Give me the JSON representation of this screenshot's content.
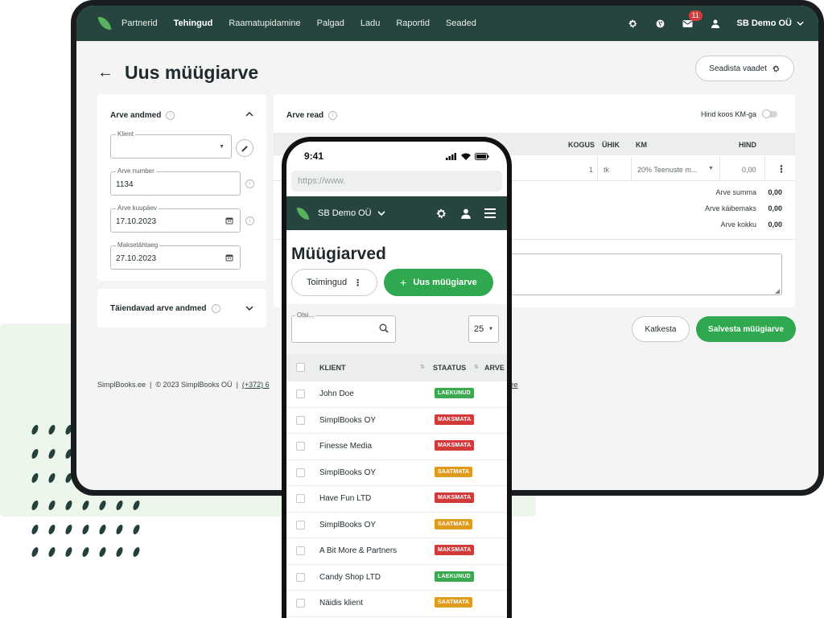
{
  "colors": {
    "brand_dark": "#27453f",
    "accent_green": "#2fa84f",
    "status_paid": "#3aa94f",
    "status_unpaid": "#d23a3a",
    "status_sent": "#e19b1c"
  },
  "desktop": {
    "nav": {
      "items": [
        "Partnerid",
        "Tehingud",
        "Raamatupidamine",
        "Palgad",
        "Ladu",
        "Raportid",
        "Seaded"
      ],
      "active": "Tehingud",
      "notification_count": "11",
      "company": "SB Demo OÜ",
      "icons": [
        "gear-icon",
        "globe-icon",
        "mail-icon",
        "user-icon"
      ]
    },
    "page_title": "Uus müügiarve",
    "settings_button": "Seadista vaadet",
    "invoice_details": {
      "title": "Arve andmed",
      "client_label": "Klient",
      "client_value": "",
      "number_label": "Arve number",
      "number_value": "1134",
      "date_label": "Arve kuupäev",
      "date_value": "17.10.2023",
      "due_label": "Maksetähtaeg",
      "due_value": "27.10.2023"
    },
    "extra_details_title": "Täiendavad arve andmed",
    "invoice_rows": {
      "title": "Arve read",
      "vat_toggle_label": "Hind koos KM-ga",
      "columns": {
        "qty": "KOGUS",
        "unit": "ÜHIK",
        "vat": "KM",
        "price": "HIND"
      },
      "row": {
        "qty": "1",
        "unit": "tk",
        "vat": "20% Teenuste m...",
        "price": "0,00"
      },
      "totals": [
        {
          "label": "Arve summa",
          "value": "0,00"
        },
        {
          "label": "Arve käibemaks",
          "value": "0,00"
        },
        {
          "label": "Arve kokku",
          "value": "0,00"
        }
      ]
    },
    "cancel_button": "Katkesta",
    "save_button": "Salvesta müügiarve",
    "footer": {
      "site": "SimplBooks.ee",
      "copyright": "© 2023 SimplBooks OÜ",
      "phone_fragment": "(+372) 6",
      "email_fragment": ".ee"
    }
  },
  "mobile": {
    "time": "9:41",
    "url_placeholder": "https://www.",
    "company": "SB Demo OÜ",
    "title": "Müügiarved",
    "actions_button": "Toimingud",
    "new_invoice_button": "Uus müügiarve",
    "search_label": "Otsi...",
    "page_size": "25",
    "columns": {
      "client": "KLIENT",
      "status": "STAATUS",
      "amount": "ARVE N"
    },
    "rows": [
      {
        "client": "John Doe",
        "status": "LAEKUNUD",
        "type": "paid"
      },
      {
        "client": "SimplBooks OY",
        "status": "MAKSMATA",
        "type": "unpaid"
      },
      {
        "client": "Finesse Media",
        "status": "MAKSMATA",
        "type": "unpaid"
      },
      {
        "client": "SimplBooks OY",
        "status": "SAATMATA",
        "type": "sent"
      },
      {
        "client": "Have Fun LTD",
        "status": "MAKSMATA",
        "type": "unpaid"
      },
      {
        "client": "SimplBooks OY",
        "status": "SAATMATA",
        "type": "sent"
      },
      {
        "client": "A Bit More & Partners",
        "status": "MAKSMATA",
        "type": "unpaid"
      },
      {
        "client": "Candy Shop LTD",
        "status": "LAEKUNUD",
        "type": "paid"
      },
      {
        "client": "Näidis klient",
        "status": "SAATMATA",
        "type": "sent"
      }
    ]
  }
}
